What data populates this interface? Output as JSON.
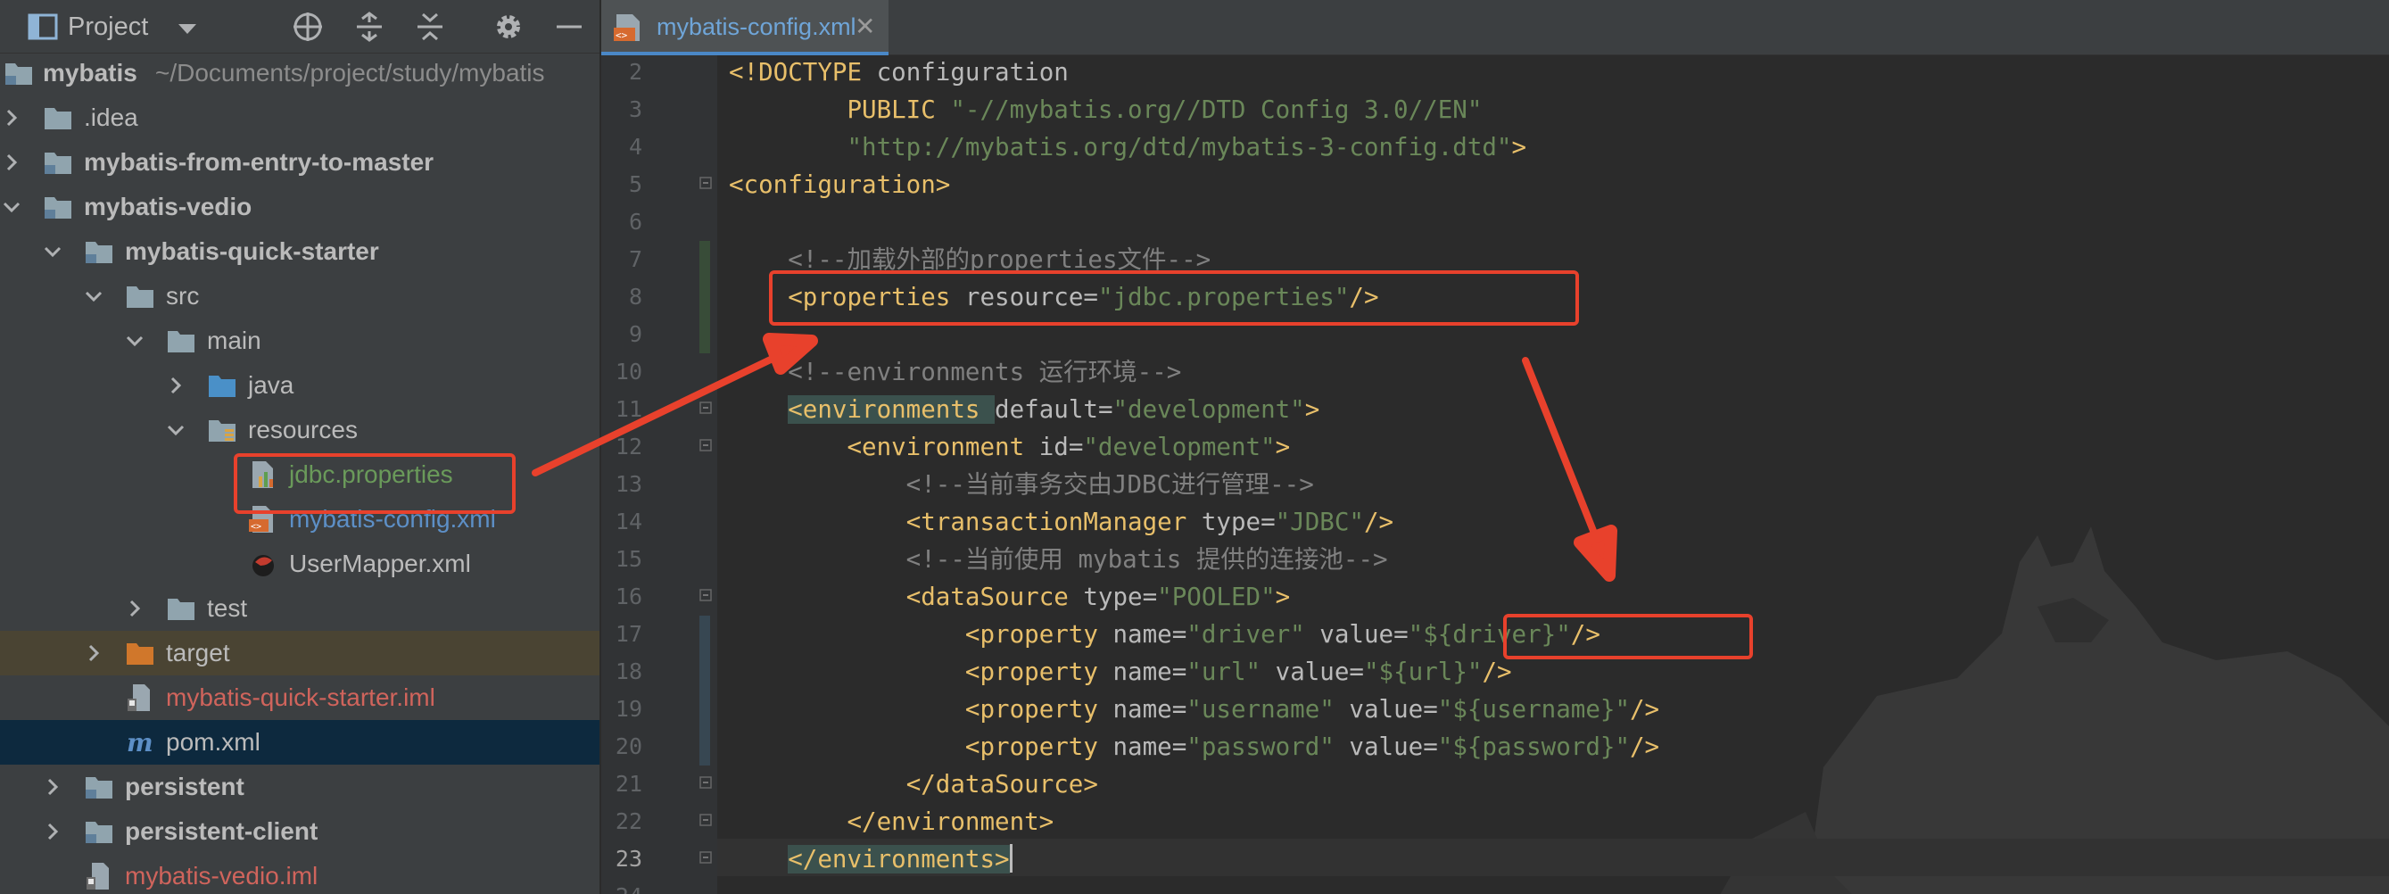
{
  "project_panel": {
    "title": "Project",
    "header_icons": [
      "locate-icon",
      "expand-all-icon",
      "collapse-all-icon",
      "gear-icon",
      "minimize-icon"
    ],
    "tree": [
      {
        "label": "mybatis",
        "path": "~/Documents/project/study/mybatis",
        "icon": "module-folder-icon",
        "expanded": true
      },
      {
        "label": ".idea",
        "icon": "folder-icon",
        "expanded": false
      },
      {
        "label": "mybatis-from-entry-to-master",
        "icon": "module-folder-icon",
        "expanded": false
      },
      {
        "label": "mybatis-vedio",
        "icon": "module-folder-icon",
        "expanded": true
      },
      {
        "label": "mybatis-quick-starter",
        "icon": "module-folder-icon",
        "expanded": true
      },
      {
        "label": "src",
        "icon": "folder-icon",
        "expanded": true
      },
      {
        "label": "main",
        "icon": "folder-icon",
        "expanded": true
      },
      {
        "label": "java",
        "icon": "source-folder-icon",
        "expanded": false
      },
      {
        "label": "resources",
        "icon": "resources-folder-icon",
        "expanded": true
      },
      {
        "label": "jdbc.properties",
        "icon": "properties-file-icon",
        "color": "#6a9a5a"
      },
      {
        "label": "mybatis-config.xml",
        "icon": "xml-file-icon",
        "color": "#5d8fc6"
      },
      {
        "label": "UserMapper.xml",
        "icon": "mybatis-xml-icon"
      },
      {
        "label": "test",
        "icon": "folder-icon",
        "expanded": false
      },
      {
        "label": "target",
        "icon": "excluded-folder-icon",
        "expanded": false
      },
      {
        "label": "mybatis-quick-starter.iml",
        "icon": "iml-file-icon",
        "color": "#d0645c"
      },
      {
        "label": "pom.xml",
        "icon": "maven-icon"
      },
      {
        "label": "persistent",
        "icon": "module-folder-icon",
        "expanded": false
      },
      {
        "label": "persistent-client",
        "icon": "module-folder-icon",
        "expanded": false
      },
      {
        "label": "mybatis-vedio.iml",
        "icon": "iml-file-icon",
        "color": "#d0645c"
      }
    ]
  },
  "editor": {
    "tab": {
      "label": "mybatis-config.xml",
      "close": "✕"
    },
    "current_line": "23",
    "lines": [
      {
        "n": "2",
        "parts": [
          [
            "p",
            "<!DOCTYPE "
          ],
          [
            "a",
            "configuration"
          ]
        ]
      },
      {
        "n": "3",
        "parts": [
          [
            "a",
            "        "
          ],
          [
            "p",
            "PUBLIC "
          ],
          [
            "v",
            "\"-//mybatis.org//DTD Config 3.0//EN\""
          ]
        ]
      },
      {
        "n": "4",
        "parts": [
          [
            "a",
            "        "
          ],
          [
            "v",
            "\"http://mybatis.org/dtd/mybatis-3-config.dtd\""
          ],
          [
            "p",
            ">"
          ]
        ]
      },
      {
        "n": "5",
        "parts": [
          [
            "t",
            "<configuration>"
          ]
        ]
      },
      {
        "n": "6",
        "parts": []
      },
      {
        "n": "7",
        "parts": [
          [
            "c",
            "    <!--加载外部的properties文件-->"
          ]
        ]
      },
      {
        "n": "8",
        "parts": [
          [
            "a",
            "    "
          ],
          [
            "t",
            "<properties "
          ],
          [
            "a",
            "resource"
          ],
          [
            "a",
            "="
          ],
          [
            "v",
            "\"jdbc.properties\""
          ],
          [
            "t",
            "/>"
          ]
        ]
      },
      {
        "n": "9",
        "parts": []
      },
      {
        "n": "10",
        "parts": [
          [
            "c",
            "    <!--environments 运行环境-->"
          ]
        ]
      },
      {
        "n": "11",
        "parts": [
          [
            "a",
            "    "
          ],
          [
            "t",
            "<environments "
          ],
          [
            "a",
            "default"
          ],
          [
            "a",
            "="
          ],
          [
            "v",
            "\"development\""
          ],
          [
            "t",
            ">"
          ]
        ]
      },
      {
        "n": "12",
        "parts": [
          [
            "a",
            "        "
          ],
          [
            "t",
            "<environment "
          ],
          [
            "a",
            "id"
          ],
          [
            "a",
            "="
          ],
          [
            "v",
            "\"development\""
          ],
          [
            "t",
            ">"
          ]
        ]
      },
      {
        "n": "13",
        "parts": [
          [
            "c",
            "            <!--当前事务交由JDBC进行管理-->"
          ]
        ]
      },
      {
        "n": "14",
        "parts": [
          [
            "a",
            "            "
          ],
          [
            "t",
            "<transactionManager "
          ],
          [
            "a",
            "type"
          ],
          [
            "a",
            "="
          ],
          [
            "v",
            "\"JDBC\""
          ],
          [
            "t",
            "/>"
          ]
        ]
      },
      {
        "n": "15",
        "parts": [
          [
            "c",
            "            <!--当前使用 mybatis 提供的连接池-->"
          ]
        ]
      },
      {
        "n": "16",
        "parts": [
          [
            "a",
            "            "
          ],
          [
            "t",
            "<dataSource "
          ],
          [
            "a",
            "type"
          ],
          [
            "a",
            "="
          ],
          [
            "v",
            "\"POOLED\""
          ],
          [
            "t",
            ">"
          ]
        ]
      },
      {
        "n": "17",
        "parts": [
          [
            "a",
            "                "
          ],
          [
            "t",
            "<property "
          ],
          [
            "a",
            "name"
          ],
          [
            "a",
            "="
          ],
          [
            "v",
            "\"driver\""
          ],
          [
            "a",
            " value"
          ],
          [
            "a",
            "="
          ],
          [
            "v",
            "\"${driver}\""
          ],
          [
            "t",
            "/>"
          ]
        ]
      },
      {
        "n": "18",
        "parts": [
          [
            "a",
            "                "
          ],
          [
            "t",
            "<property "
          ],
          [
            "a",
            "name"
          ],
          [
            "a",
            "="
          ],
          [
            "v",
            "\"url\""
          ],
          [
            "a",
            " value"
          ],
          [
            "a",
            "="
          ],
          [
            "v",
            "\"${url}\""
          ],
          [
            "t",
            "/>"
          ]
        ]
      },
      {
        "n": "19",
        "parts": [
          [
            "a",
            "                "
          ],
          [
            "t",
            "<property "
          ],
          [
            "a",
            "name"
          ],
          [
            "a",
            "="
          ],
          [
            "v",
            "\"username\""
          ],
          [
            "a",
            " value"
          ],
          [
            "a",
            "="
          ],
          [
            "v",
            "\"${username}\""
          ],
          [
            "t",
            "/>"
          ]
        ]
      },
      {
        "n": "20",
        "parts": [
          [
            "a",
            "                "
          ],
          [
            "t",
            "<property "
          ],
          [
            "a",
            "name"
          ],
          [
            "a",
            "="
          ],
          [
            "v",
            "\"password\""
          ],
          [
            "a",
            " value"
          ],
          [
            "a",
            "="
          ],
          [
            "v",
            "\"${password}\""
          ],
          [
            "t",
            "/>"
          ]
        ]
      },
      {
        "n": "21",
        "parts": [
          [
            "a",
            "            "
          ],
          [
            "t",
            "</dataSource>"
          ]
        ]
      },
      {
        "n": "22",
        "parts": [
          [
            "a",
            "        "
          ],
          [
            "t",
            "</environment>"
          ]
        ]
      },
      {
        "n": "23",
        "parts": [
          [
            "a",
            "    "
          ],
          [
            "t",
            "</environments>"
          ]
        ]
      },
      {
        "n": "24",
        "parts": []
      }
    ]
  },
  "annotations": {
    "color": "#e8412c",
    "boxes": [
      "jdbc-properties-highlight",
      "properties-tag-highlight",
      "driver-value-highlight"
    ]
  },
  "colors": {
    "tag": "#e8bf6a",
    "attr_value": "#6a8759",
    "comment": "#808080",
    "text": "#a9b7c6",
    "panel_bg": "#3c3f41",
    "editor_bg": "#2b2b2b"
  }
}
